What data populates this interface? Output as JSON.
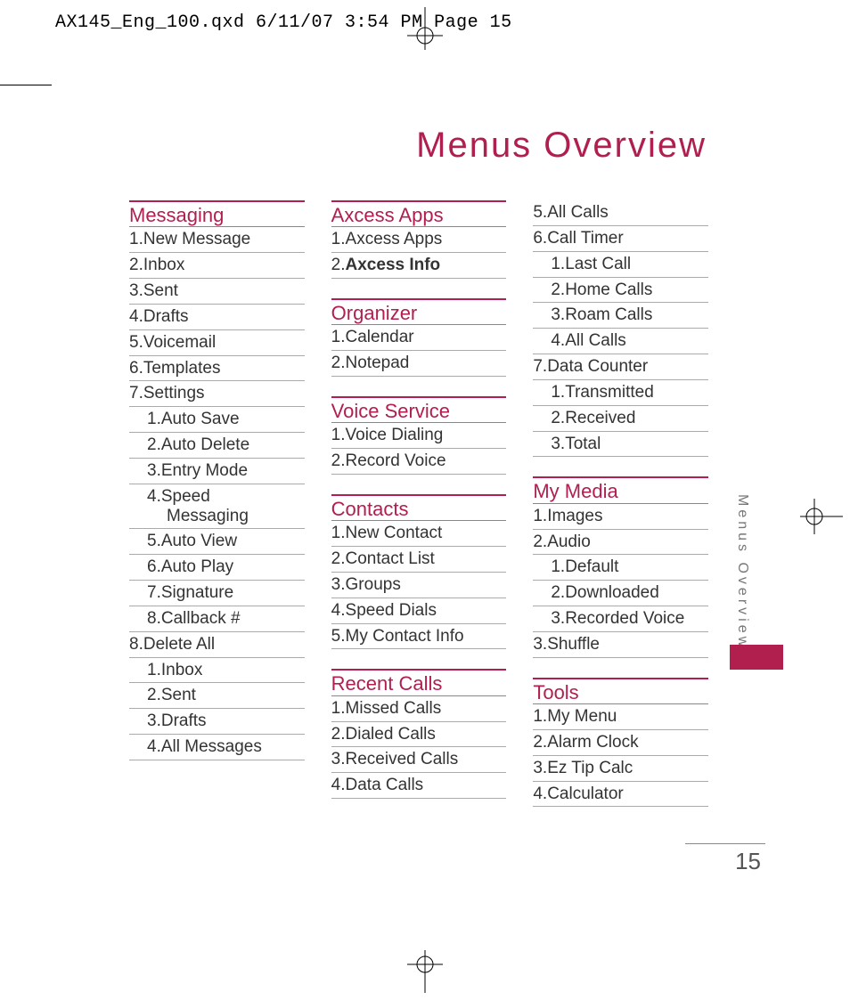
{
  "slug": "AX145_Eng_100.qxd  6/11/07  3:54 PM  Page 15",
  "title": "Menus Overview",
  "side_label": "Menus Overview",
  "page_number": "15",
  "columns": [
    {
      "sections": [
        {
          "title": "Messaging",
          "first": true,
          "items": [
            {
              "n": "1.",
              "t": "New Message"
            },
            {
              "n": "2.",
              "t": "Inbox"
            },
            {
              "n": "3.",
              "t": "Sent"
            },
            {
              "n": "4.",
              "t": "Drafts"
            },
            {
              "n": "5.",
              "t": "Voicemail"
            },
            {
              "n": "6.",
              "t": "Templates"
            },
            {
              "n": "7.",
              "t": "Settings",
              "subs": [
                {
                  "n": "1.",
                  "t": "Auto Save"
                },
                {
                  "n": "2.",
                  "t": "Auto Delete"
                },
                {
                  "n": "3.",
                  "t": "Entry Mode"
                },
                {
                  "n": "4.",
                  "t": "Speed",
                  "wrap": "Messaging"
                },
                {
                  "n": "5.",
                  "t": "Auto View"
                },
                {
                  "n": "6.",
                  "t": "Auto Play"
                },
                {
                  "n": "7.",
                  "t": "Signature"
                },
                {
                  "n": "8.",
                  "t": "Callback #"
                }
              ]
            },
            {
              "n": "8.",
              "t": "Delete All",
              "subs": [
                {
                  "n": "1.",
                  "t": "Inbox"
                },
                {
                  "n": "2.",
                  "t": "Sent"
                },
                {
                  "n": "3.",
                  "t": "Drafts"
                },
                {
                  "n": "4.",
                  "t": "All Messages"
                }
              ]
            }
          ]
        }
      ]
    },
    {
      "sections": [
        {
          "title": "Axcess Apps",
          "first": true,
          "items": [
            {
              "n": "1.",
              "t": "Axcess Apps"
            },
            {
              "n": "2.",
              "t": "Axcess Info",
              "bold": true
            }
          ]
        },
        {
          "title": "Organizer",
          "items": [
            {
              "n": "1.",
              "t": "Calendar"
            },
            {
              "n": "2.",
              "t": "Notepad"
            }
          ]
        },
        {
          "title": "Voice Service",
          "items": [
            {
              "n": "1.",
              "t": "Voice Dialing"
            },
            {
              "n": "2.",
              "t": "Record Voice"
            }
          ]
        },
        {
          "title": "Contacts",
          "items": [
            {
              "n": "1.",
              "t": "New Contact"
            },
            {
              "n": "2.",
              "t": "Contact List"
            },
            {
              "n": "3.",
              "t": "Groups"
            },
            {
              "n": "4.",
              "t": "Speed Dials"
            },
            {
              "n": "5.",
              "t": "My Contact Info"
            }
          ]
        },
        {
          "title": "Recent Calls",
          "items": [
            {
              "n": "1.",
              "t": "Missed Calls"
            },
            {
              "n": "2.",
              "t": "Dialed Calls"
            },
            {
              "n": "3.",
              "t": "Received Calls"
            },
            {
              "n": "4.",
              "t": "Data Calls"
            }
          ]
        }
      ]
    },
    {
      "sections": [
        {
          "continuation": true,
          "items": [
            {
              "n": "5.",
              "t": "All Calls"
            },
            {
              "n": "6.",
              "t": "Call Timer",
              "subs": [
                {
                  "n": "1.",
                  "t": "Last Call"
                },
                {
                  "n": "2.",
                  "t": "Home Calls"
                },
                {
                  "n": "3.",
                  "t": "Roam Calls"
                },
                {
                  "n": "4.",
                  "t": "All Calls"
                }
              ]
            },
            {
              "n": "7.",
              "t": "Data Counter",
              "subs": [
                {
                  "n": "1.",
                  "t": "Transmitted"
                },
                {
                  "n": "2.",
                  "t": "Received"
                },
                {
                  "n": "3.",
                  "t": "Total"
                }
              ]
            }
          ]
        },
        {
          "title": "My Media",
          "items": [
            {
              "n": "1.",
              "t": "Images"
            },
            {
              "n": "2.",
              "t": "Audio",
              "subs": [
                {
                  "n": "1.",
                  "t": "Default"
                },
                {
                  "n": "2.",
                  "t": "Downloaded"
                },
                {
                  "n": "3.",
                  "t": "Recorded Voice"
                }
              ]
            },
            {
              "n": "3.",
              "t": "Shuffle"
            }
          ]
        },
        {
          "title": "Tools",
          "items": [
            {
              "n": "1.",
              "t": "My Menu"
            },
            {
              "n": "2.",
              "t": "Alarm Clock"
            },
            {
              "n": "3.",
              "t": "Ez Tip Calc"
            },
            {
              "n": "4.",
              "t": "Calculator"
            }
          ]
        }
      ]
    }
  ]
}
